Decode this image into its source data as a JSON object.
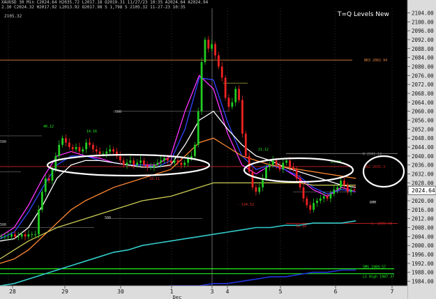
{
  "header": {
    "line1": "XAUUSD 30 Min C2024.64 H2035.72 L2017.18 O2019.31 11/27/23 10:35 A2024.64 A2024.94",
    "line2": "2.30 C2024.32 H2017.92 L2013.92 O2017.98 S 1,798 S 2105.32 11-27-23 10:35",
    "line3": "2105.32"
  },
  "legend_title": "T=Q Levels New",
  "colors": {
    "background": "#000000",
    "up_candle": "#22cc22",
    "down_candle": "#ee2222",
    "ma_fast": "#ff33ff",
    "ma_blue": "#3344ff",
    "ma_white": "#ffffff",
    "ma_orange": "#ff8833",
    "ma_yellow": "#cccc55",
    "ma_cyan": "#33cccc",
    "ma_darkblue": "#2233dd",
    "level_green": "#22ee22",
    "highlight_ellipse": "#ffffff"
  },
  "chart_data": {
    "type": "candlestick",
    "symbol": "XAUUSD",
    "timeframe": "30 Min",
    "ylim": [
      1982,
      2106
    ],
    "y_ticks": [
      2104,
      2100,
      2096,
      2092,
      2088,
      2084,
      2080,
      2076,
      2072,
      2068,
      2064,
      2060,
      2056,
      2052,
      2048,
      2044,
      2040,
      2036,
      2032,
      2028,
      2024,
      2020,
      2016,
      2012,
      2008,
      2004,
      2000,
      1996,
      1992,
      1988,
      1984
    ],
    "y_tick_labels": [
      "2104.00",
      "2100.00",
      "2096.00",
      "2092.00",
      "2088.00",
      "2084.00",
      "2080.00",
      "2076.00",
      "2072.00",
      "2068.00",
      "2064.00",
      "2060.00",
      "2056.00",
      "2052.00",
      "2048.00",
      "2044.00",
      "2040.00",
      "2036.00",
      "2032.00",
      "2028.00",
      "2024.00",
      "2020.00",
      "2016.00",
      "2012.00",
      "2008.00",
      "2004.00",
      "2000.00",
      "1996.00",
      "1992.00",
      "1988.00",
      "1984.00"
    ],
    "x_ticks": [
      "28",
      "29",
      "30",
      "1",
      "3",
      "4",
      "5",
      "6",
      "7"
    ],
    "x_month_label": "Dec",
    "current_price": "2024.64",
    "horizontal_levels": [
      {
        "label": "BR3 2082.94",
        "value": 2082.9,
        "color": "#e08040"
      },
      {
        "label": "R 2041.14",
        "value": 2041.1,
        "color": "#888888"
      },
      {
        "label": "BR2 2035.3",
        "value": 2035.3,
        "color": "#cc2222"
      },
      {
        "label": "S. 2009.94",
        "value": 2009.9,
        "color": "#cc2222"
      },
      {
        "label": "SMS 1989.57",
        "value": 1989.6,
        "color": "#22ee22"
      },
      {
        "label": "LS High 1987.37",
        "value": 1987.4,
        "color": "#22ee22"
      }
    ],
    "annotations": [
      {
        "text": "40.12",
        "color": "#22ee22"
      },
      {
        "text": "14.16",
        "color": "#22ee22"
      },
      {
        "text": "- 18.11",
        "color": "#ee3333"
      },
      {
        "text": "21.12",
        "color": "#22ee22"
      },
      {
        "text": "25.68",
        "color": "#22ee22"
      },
      {
        "text": "- 124.52",
        "color": "#ee3333"
      },
      {
        "text": "31.39",
        "color": "#ee3333"
      },
      {
        "text": ".500",
        "color": "#cccccc"
      },
      {
        "text": "500",
        "color": "#cccccc"
      },
      {
        "text": "RMM",
        "color": "#cccccc"
      },
      {
        "text": "500",
        "color": "#cccccc"
      },
      {
        "text": "500",
        "color": "#cccccc"
      }
    ],
    "candles_close": [
      2004,
      2004,
      2004,
      2005,
      2004,
      2004,
      2005,
      2004,
      2005,
      2005,
      2005,
      2016,
      2024,
      2030,
      2029,
      2034,
      2040,
      2045,
      2048,
      2046,
      2044,
      2043,
      2044,
      2042,
      2043,
      2046,
      2045,
      2043,
      2042,
      2041,
      2041,
      2042,
      2043,
      2042,
      2040,
      2038,
      2036,
      2037,
      2038,
      2036,
      2037,
      2038,
      2036,
      2035,
      2035,
      2036,
      2037,
      2038,
      2039,
      2038,
      2037,
      2038,
      2037,
      2036,
      2037,
      2039,
      2040,
      2045,
      2060,
      2082,
      2092,
      2088,
      2090,
      2085,
      2080,
      2075,
      2066,
      2062,
      2064,
      2070,
      2065,
      2050,
      2040,
      2033,
      2026,
      2024,
      2026,
      2030,
      2035,
      2036,
      2038,
      2036,
      2034,
      2037,
      2038,
      2035,
      2034,
      2030,
      2026,
      2021,
      2018,
      2016,
      2019,
      2020,
      2021,
      2022,
      2021,
      2023,
      2025,
      2026,
      2029,
      2027,
      2024,
      2025,
      2024.6
    ],
    "overlay_series": [
      {
        "name": "",
        "color": "#ff33ff",
        "values": [
          2004,
          2008,
          2018,
          2030,
          2040,
          2042,
          2040,
          2039,
          2037,
          2036,
          2036,
          2036,
          2040,
          2060,
          2076,
          2070,
          2050,
          2036,
          2032,
          2036,
          2034,
          2030,
          2025,
          2022,
          2026,
          2024
        ]
      },
      {
        "name": "",
        "color": "#3344ff",
        "values": [
          2003,
          2006,
          2015,
          2026,
          2036,
          2040,
          2040,
          2038,
          2037,
          2036,
          2036,
          2035,
          2038,
          2052,
          2075,
          2074,
          2055,
          2040,
          2034,
          2036,
          2034,
          2031,
          2026,
          2023,
          2025,
          2024
        ]
      },
      {
        "name": "",
        "color": "#ffffff",
        "values": [
          2002,
          2003,
          2008,
          2018,
          2030,
          2036,
          2038,
          2038,
          2037,
          2036,
          2035,
          2035,
          2036,
          2045,
          2056,
          2060,
          2052,
          2045,
          2040,
          2038,
          2035,
          2033,
          2031,
          2029,
          2027,
          2026
        ]
      },
      {
        "name": "",
        "color": "#ff8833",
        "values": [
          1992,
          1994,
          1998,
          2004,
          2010,
          2016,
          2020,
          2023,
          2026,
          2028,
          2030,
          2032,
          2034,
          2040,
          2046,
          2048,
          2044,
          2040,
          2038,
          2036,
          2035,
          2034,
          2033,
          2032,
          2031,
          2030
        ]
      },
      {
        "name": "",
        "color": "#cccc55",
        "values": [
          1994,
          1998,
          2002,
          2005,
          2008,
          2010,
          2012,
          2014,
          2016,
          2018,
          2020,
          2021,
          2022,
          2024,
          2026,
          2028,
          2028,
          2028,
          2028,
          2028,
          2028,
          2028,
          2027,
          2027,
          2027,
          2027
        ]
      },
      {
        "name": "",
        "color": "#33cccc",
        "values": [
          1982,
          1983,
          1985,
          1987,
          1989,
          1991,
          1993,
          1995,
          1997,
          1998,
          2000,
          2001,
          2002,
          2003,
          2004,
          2005,
          2006,
          2007,
          2008,
          2008,
          2009,
          2009,
          2010,
          2010,
          2010,
          2011
        ]
      },
      {
        "name": "",
        "color": "#2233dd",
        "values": [
          1978,
          1978,
          1979,
          1979,
          1979,
          1980,
          1980,
          1980,
          1980,
          1981,
          1981,
          1981,
          1982,
          1982,
          1982,
          1983,
          1983,
          1984,
          1985,
          1986,
          1986,
          1987,
          1988,
          1988,
          1989,
          1989
        ]
      }
    ]
  }
}
